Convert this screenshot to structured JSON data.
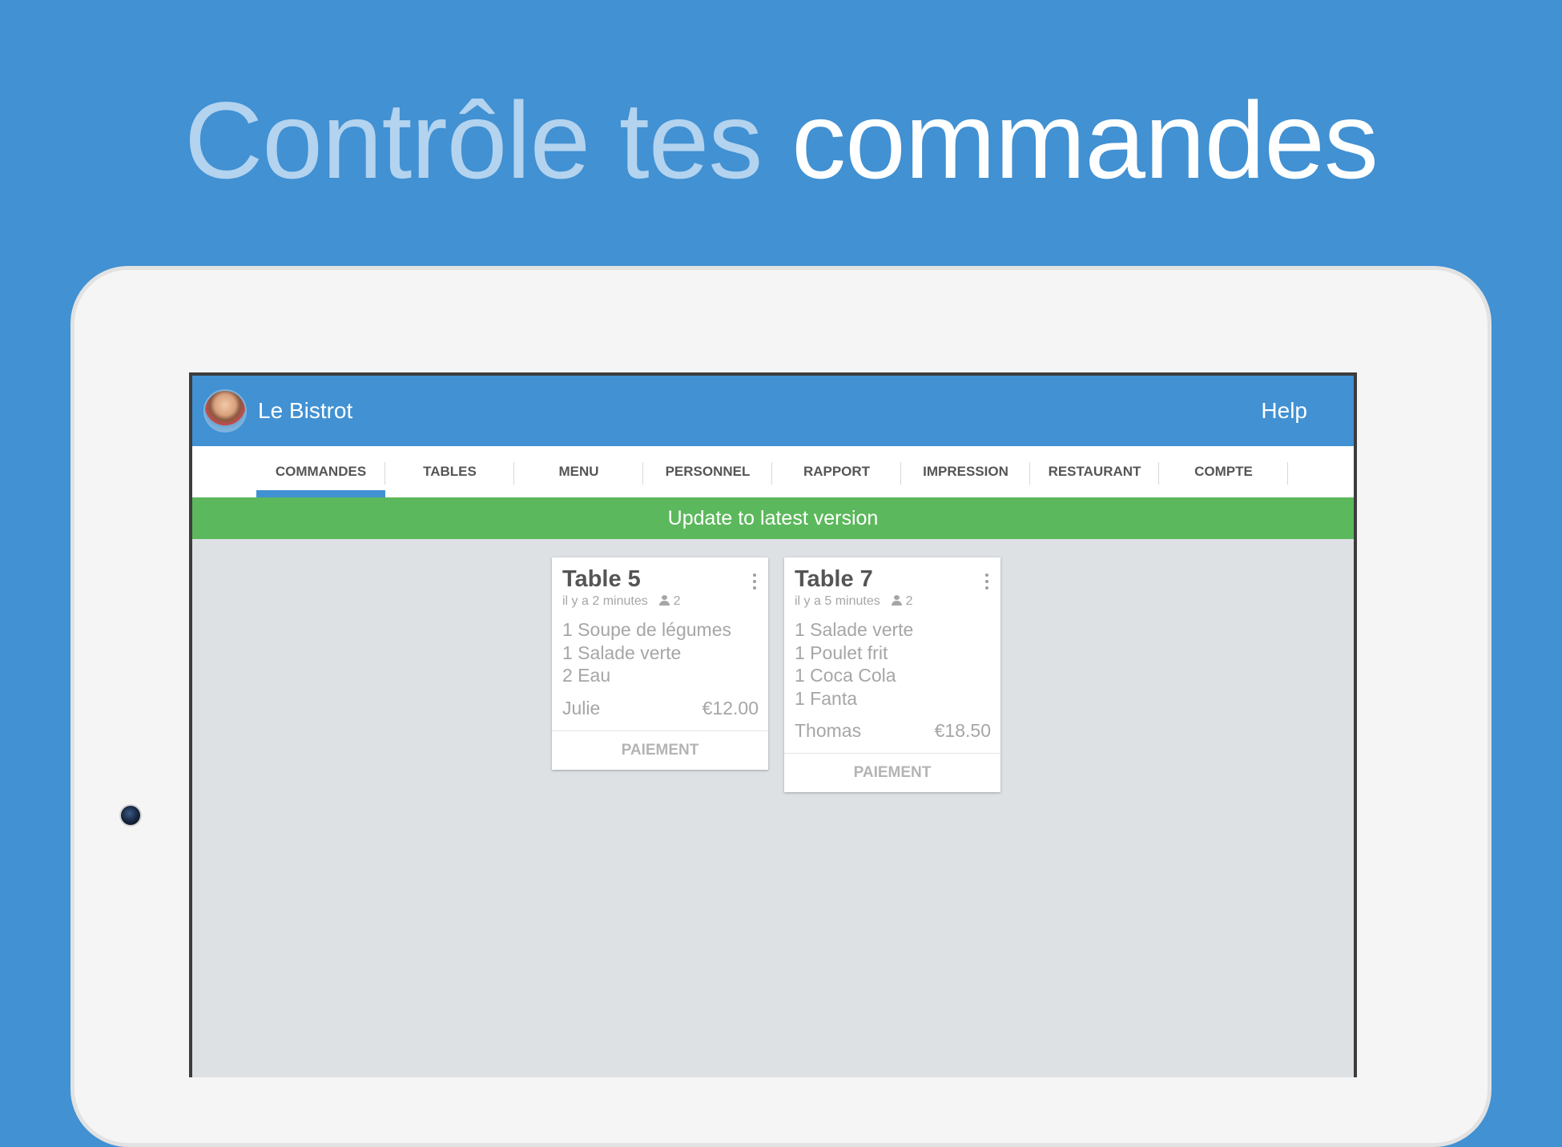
{
  "headline": {
    "part1": "Contrôle tes ",
    "part2": "commandes"
  },
  "app": {
    "name": "Le Bistrot",
    "help_label": "Help"
  },
  "tabs": [
    {
      "label": "COMMANDES",
      "active": true
    },
    {
      "label": "TABLES"
    },
    {
      "label": "MENU"
    },
    {
      "label": "PERSONNEL"
    },
    {
      "label": "RAPPORT"
    },
    {
      "label": "IMPRESSION"
    },
    {
      "label": "RESTAURANT"
    },
    {
      "label": "COMPTE"
    }
  ],
  "update_banner": "Update to latest version",
  "orders": [
    {
      "table": "Table 5",
      "time": "il y a 2 minutes",
      "guests": "2",
      "items": [
        "1 Soupe de légumes",
        "1 Salade verte",
        "2 Eau"
      ],
      "server": "Julie",
      "total": "€12.00",
      "action": "PAIEMENT"
    },
    {
      "table": "Table 7",
      "time": "il y a 5 minutes",
      "guests": "2",
      "items": [
        "1 Salade verte",
        "1 Poulet frit",
        "1 Coca Cola",
        "1 Fanta"
      ],
      "server": "Thomas",
      "total": "€18.50",
      "action": "PAIEMENT"
    }
  ],
  "colors": {
    "brand_blue": "#4191d3",
    "update_green": "#5cb85c"
  }
}
